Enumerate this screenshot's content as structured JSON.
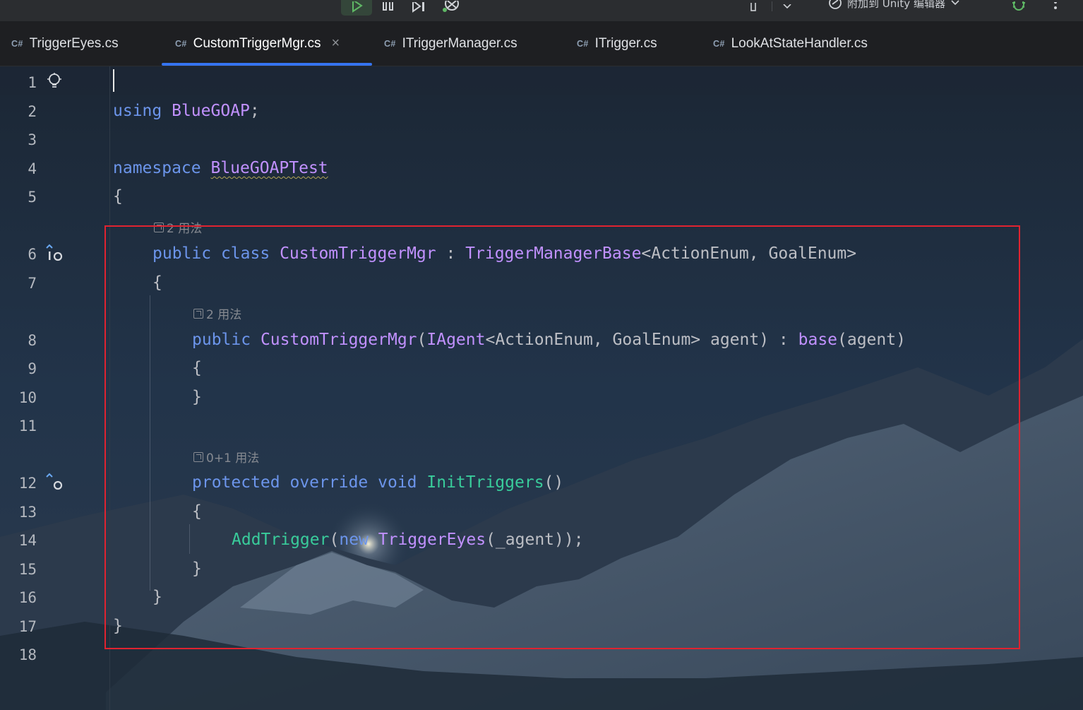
{
  "toolbar": {
    "attach_label": "附加到 Unity 编辑器",
    "icons": [
      "run-icon",
      "pause-icon",
      "step-icon",
      "debug-unity-icon",
      "attach-icon",
      "chevron-down-icon",
      "bug-icon",
      "more-vert-icon"
    ]
  },
  "tabs": [
    {
      "lang": "C#",
      "label": "TriggerEyes.cs"
    },
    {
      "lang": "C#",
      "label": "CustomTriggerMgr.cs",
      "close": "×"
    },
    {
      "lang": "C#",
      "label": "ITriggerManager.cs"
    },
    {
      "lang": "C#",
      "label": "ITrigger.cs"
    },
    {
      "lang": "C#",
      "label": "LookAtStateHandler.cs"
    }
  ],
  "editor": {
    "line_numbers": [
      "1",
      "2",
      "3",
      "4",
      "5",
      "6",
      "7",
      "8",
      "9",
      "10",
      "11",
      "12",
      "13",
      "14",
      "15",
      "16",
      "17",
      "18"
    ],
    "usages": {
      "class": "2 用法",
      "ctor": "2 用法",
      "init": "0+1 用法"
    },
    "code": {
      "l2_using": "using",
      "l2_ns": "BlueGOAP",
      "l2_semi": ";",
      "l4_namespace": "namespace",
      "l4_name": "BlueGOAPTest",
      "l5": "{",
      "l6_public": "public",
      "l6_class": "class",
      "l6_name": "CustomTriggerMgr",
      "l6_colon": " : ",
      "l6_base": "TriggerManagerBase",
      "l6_lt": "<",
      "l6_t1": "ActionEnum",
      "l6_comma": ", ",
      "l6_t2": "GoalEnum",
      "l6_gt": ">",
      "l7": "{",
      "l8_public": "public",
      "l8_name": "CustomTriggerMgr",
      "l8_paren": "(",
      "l8_iagent": "IAgent",
      "l8_lt": "<",
      "l8_t1": "ActionEnum",
      "l8_comma": ", ",
      "l8_t2": "GoalEnum",
      "l8_gt": "> agent) : ",
      "l8_base": "base",
      "l8_tail": "(agent)",
      "l9": "{",
      "l10": "}",
      "l12_protected": "protected",
      "l12_override": "override",
      "l12_void": "void",
      "l12_name": "InitTriggers",
      "l12_parens": "()",
      "l13": "{",
      "l14_call": "AddTrigger",
      "l14_open": "(",
      "l14_new": "new",
      "l14_type": "TriggerEyes",
      "l14_tail": "(_agent));",
      "l15": "}",
      "l16": "}",
      "l17": "}"
    }
  },
  "colors": {
    "keyword": "#6c95eb",
    "type": "#c191ff",
    "method": "#39cc9b",
    "text": "#bcbec4",
    "highlight_box": "#e02330",
    "tab_underline": "#3574f0"
  }
}
